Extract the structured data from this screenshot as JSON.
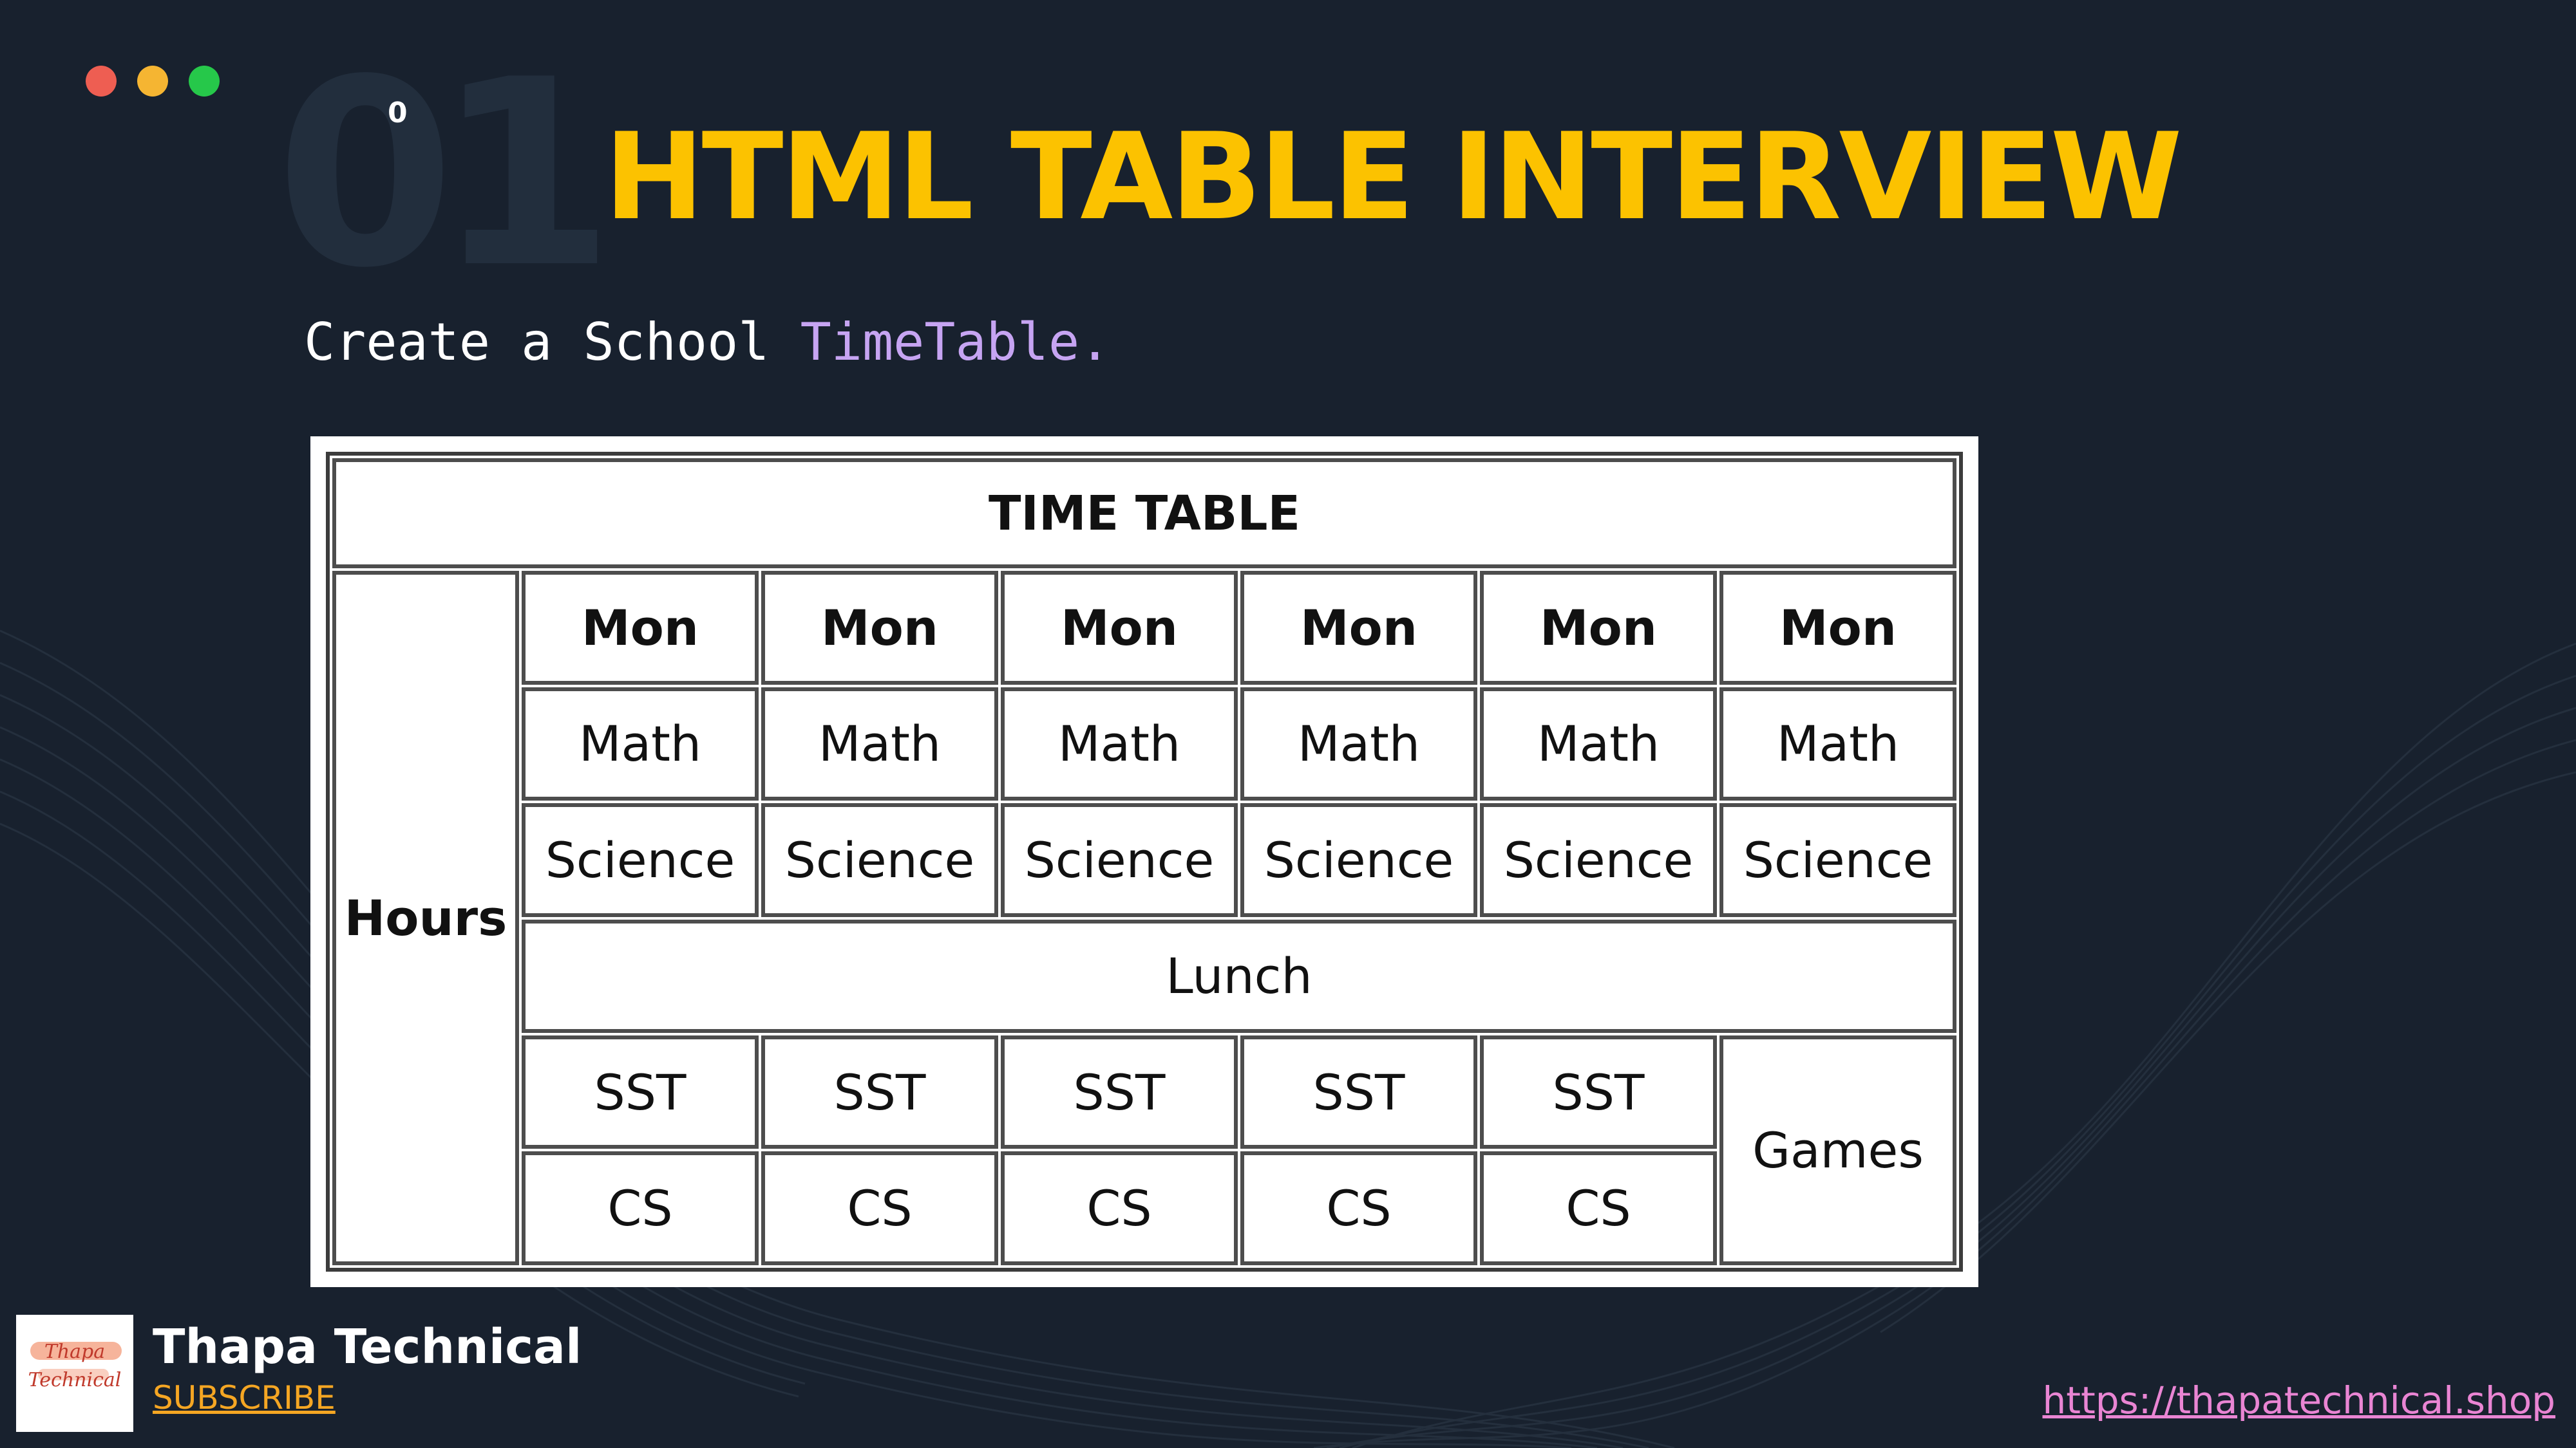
{
  "window": {
    "dots": [
      {
        "name": "close-dot",
        "color": "#ee5e52"
      },
      {
        "name": "minimize-dot",
        "color": "#f5b532"
      },
      {
        "name": "maximize-dot",
        "color": "#26c84a"
      }
    ]
  },
  "header": {
    "number": "01",
    "small_mark": "0",
    "title": "HTML TABLE INTERVIEW",
    "title_color": "#fcc200"
  },
  "prompt": {
    "text_plain": "Create a School ",
    "text_highlight": "TimeTable.",
    "highlight_color": "#c6a4f2"
  },
  "timetable": {
    "caption": "TIME TABLE",
    "row_header": "Hours",
    "days": [
      "Mon",
      "Mon",
      "Mon",
      "Mon",
      "Mon",
      "Mon"
    ],
    "rows": [
      [
        "Math",
        "Math",
        "Math",
        "Math",
        "Math",
        "Math"
      ],
      [
        "Science",
        "Science",
        "Science",
        "Science",
        "Science",
        "Science"
      ]
    ],
    "lunch": "Lunch",
    "sst": [
      "SST",
      "SST",
      "SST",
      "SST",
      "SST"
    ],
    "cs": [
      "CS",
      "CS",
      "CS",
      "CS",
      "CS"
    ],
    "games": "Games"
  },
  "footer": {
    "brand_name": "Thapa Technical",
    "subscribe": "SUBSCRIBE",
    "logo_line1": "Thapa",
    "logo_line2": "Technical",
    "url": "https://thapatechnical.shop",
    "url_color": "#e985d3"
  }
}
